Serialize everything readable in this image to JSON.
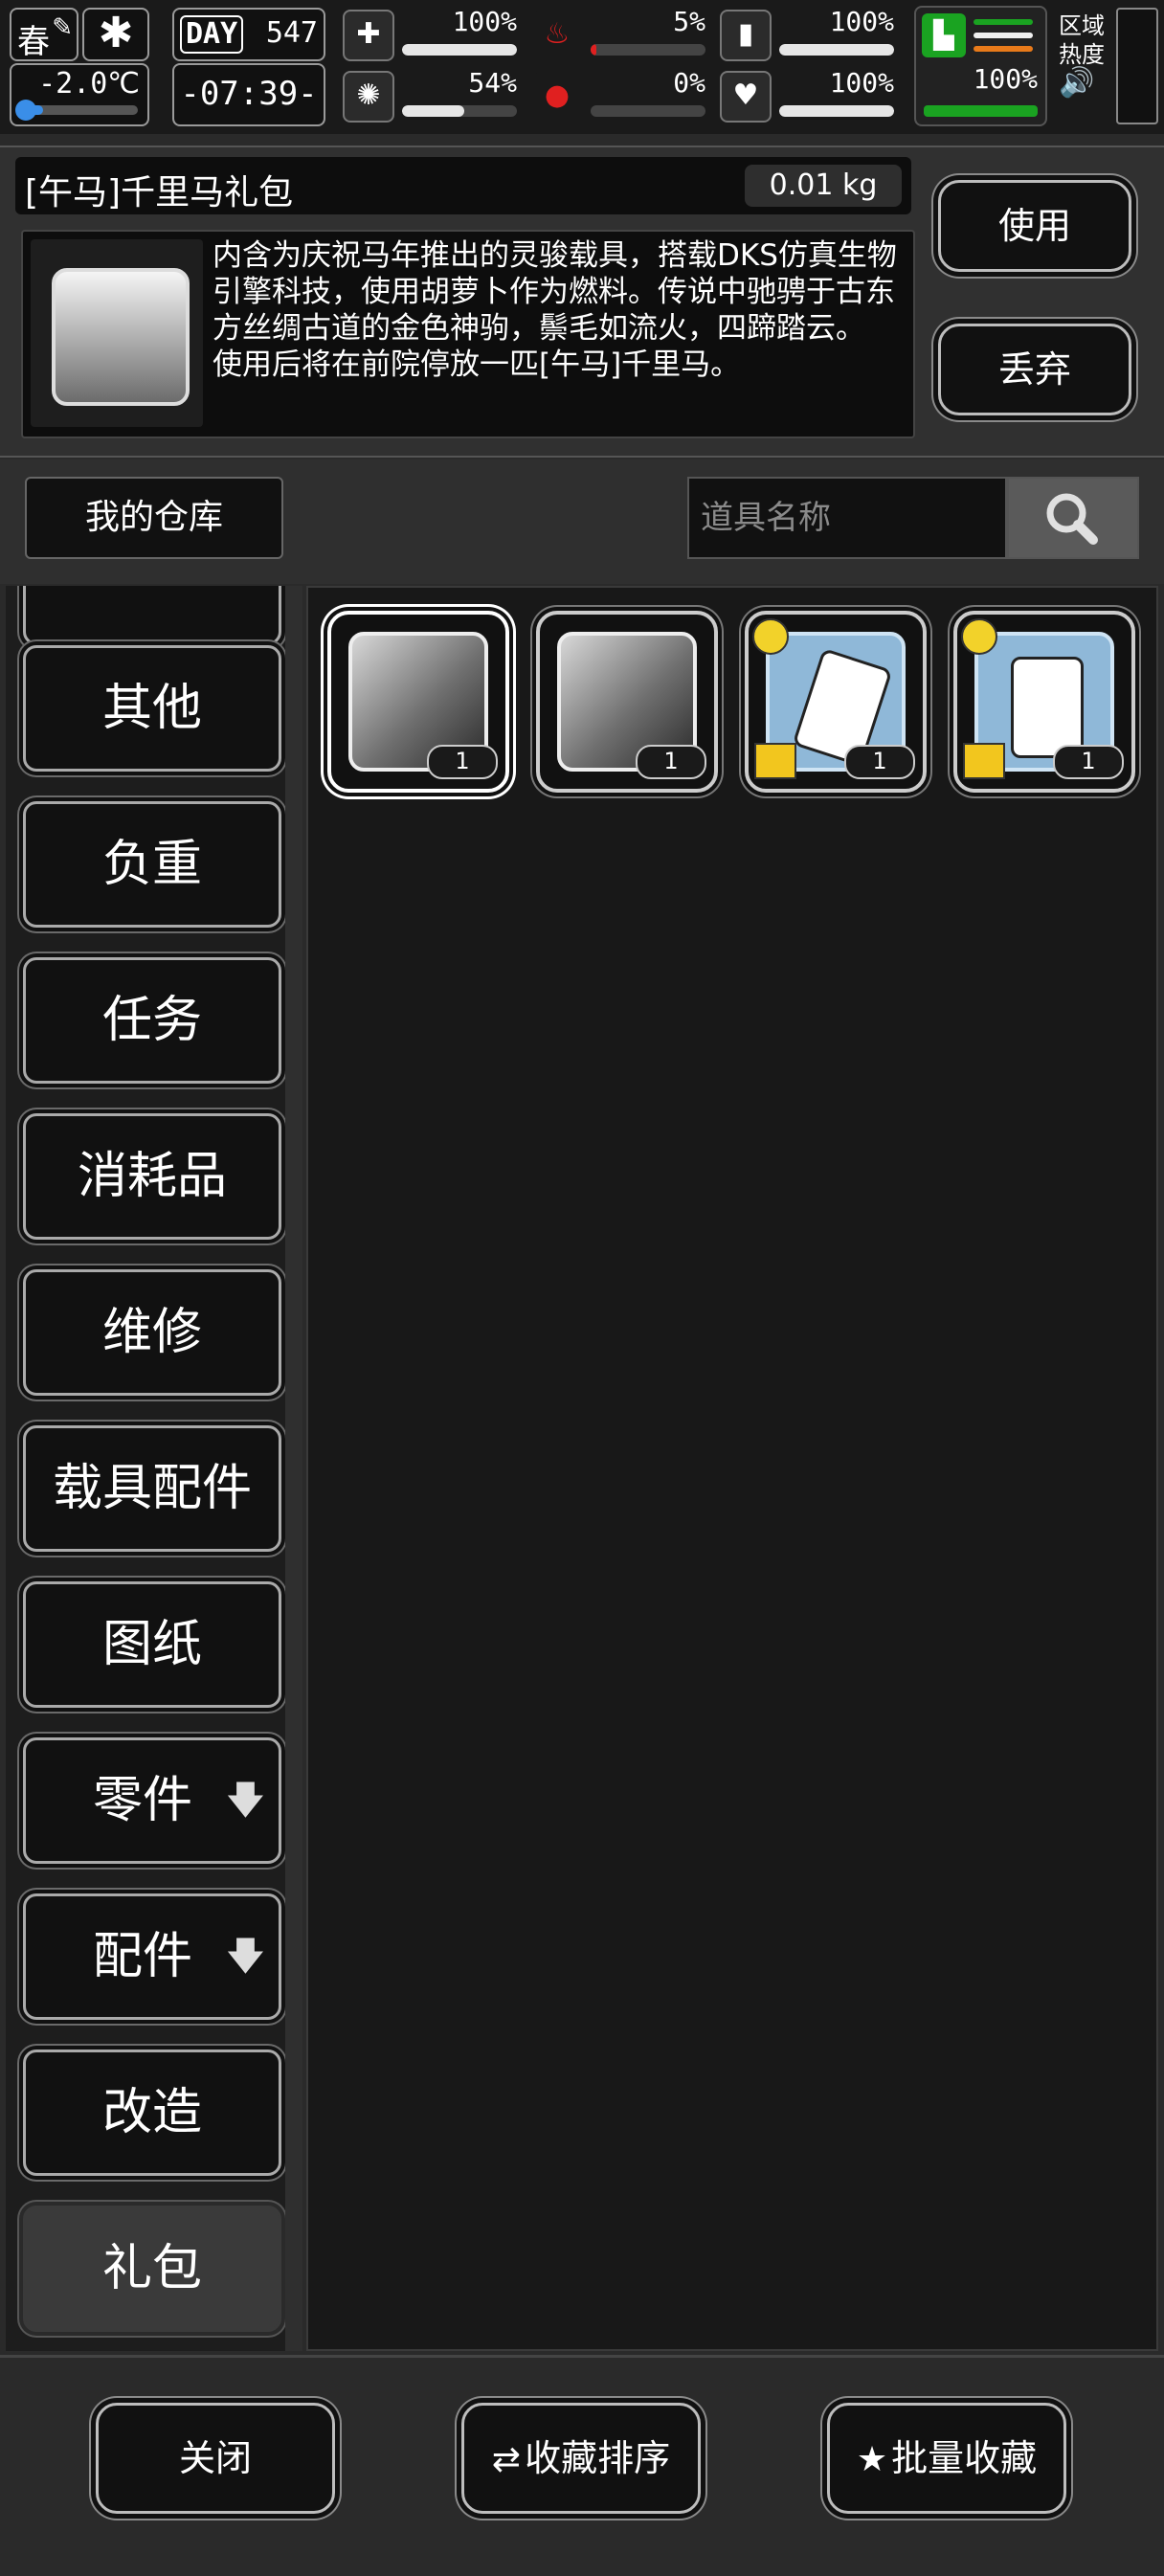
{
  "status": {
    "season": "春",
    "temperature": "-2.0℃",
    "temperature_level": 0.2,
    "day_label": "DAY",
    "day_number": "547",
    "clock": "-07:39-",
    "stats": [
      {
        "icon": "medkit-icon",
        "glyph": "✚",
        "value": "100%",
        "level": 1.0
      },
      {
        "icon": "stomach-icon",
        "glyph": "♨",
        "value": "5%",
        "level": 0.05
      },
      {
        "icon": "water-bottle-icon",
        "glyph": "▮",
        "value": "100%",
        "level": 1.0
      },
      {
        "icon": "brain-icon",
        "glyph": "✺",
        "value": "54%",
        "level": 0.54
      },
      {
        "icon": "blood-drop-icon",
        "glyph": "●",
        "value": "0%",
        "level": 0.0
      },
      {
        "icon": "heart-icon",
        "glyph": "♥",
        "value": "100%",
        "level": 1.0
      }
    ],
    "stamina_value": "100%",
    "zone_label": "区域热度",
    "colors": {
      "stamina_green": "#1aa321",
      "temp_blue": "#3a8ee8",
      "blood_red": "#e02020"
    }
  },
  "item": {
    "name": "[午马]千里马礼包",
    "weight": "0.01 kg",
    "description": [
      "内含为庆祝马年推出的灵骏载具，搭载DKS仿真生物引擎科技，使用胡萝卜作为燃料。传说中驰骋于古东方丝绸古道的金色神驹，鬃毛如流火，四蹄踏云。",
      "使用后将在前院停放一匹[午马]千里马。"
    ],
    "use_label": "使用",
    "drop_label": "丢弃"
  },
  "toolbar": {
    "warehouse_label": "我的仓库",
    "search_placeholder": "道具名称"
  },
  "categories": [
    {
      "label": "其他"
    },
    {
      "label": "负重"
    },
    {
      "label": "任务"
    },
    {
      "label": "消耗品"
    },
    {
      "label": "维修"
    },
    {
      "label": "载具配件"
    },
    {
      "label": "图纸"
    },
    {
      "label": "零件",
      "arrow": "🡇"
    },
    {
      "label": "配件",
      "arrow": "🡇"
    },
    {
      "label": "改造"
    },
    {
      "label": "礼包",
      "selected": true
    }
  ],
  "items": [
    {
      "name": "horse-gift-item",
      "qty": "1",
      "selected": true
    },
    {
      "name": "dark-horse-gift-item",
      "qty": "1"
    },
    {
      "name": "gift-case-item",
      "qty": "1"
    },
    {
      "name": "gift-vest-item",
      "qty": "1"
    }
  ],
  "bottom": {
    "close_label": "关闭",
    "sort_label": "收藏排序",
    "batch_label": "批量收藏"
  }
}
